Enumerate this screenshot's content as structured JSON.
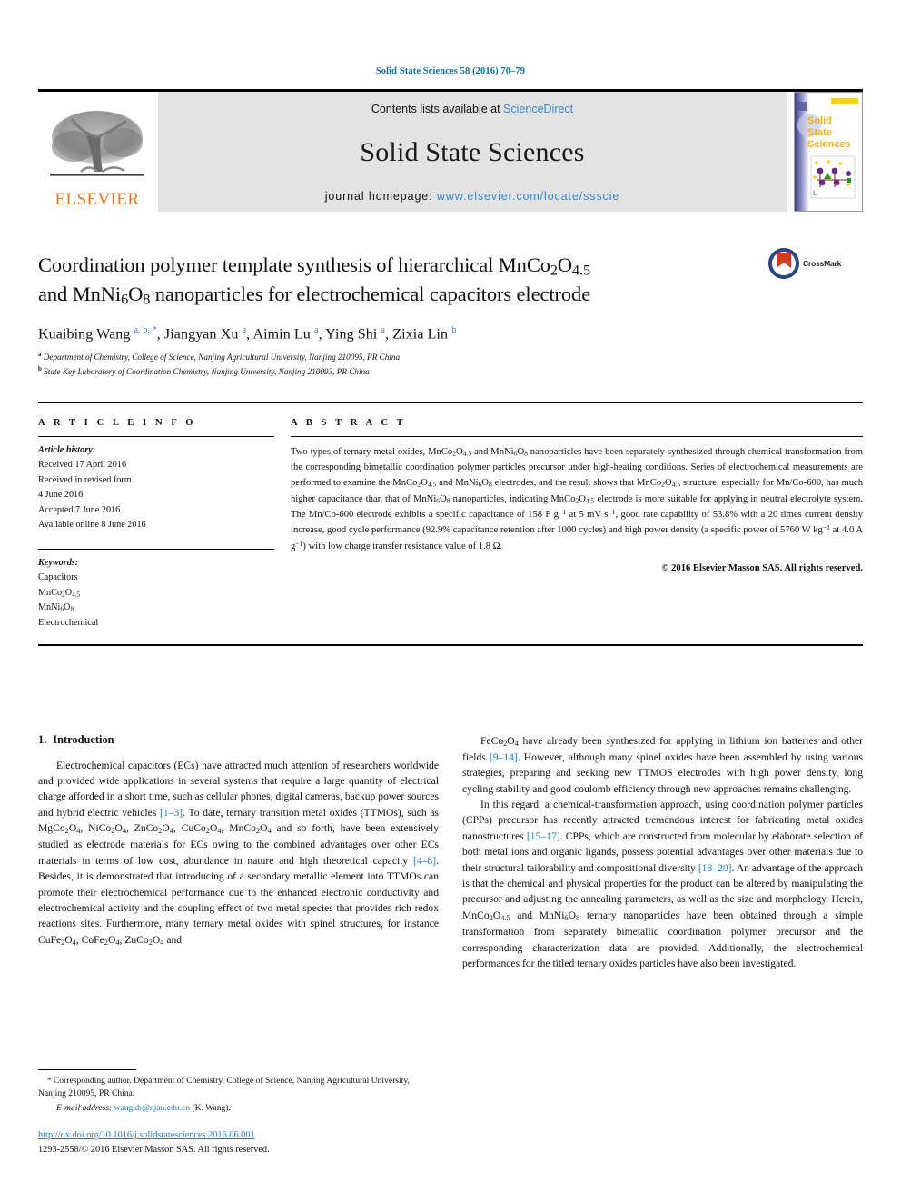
{
  "running_head": "Solid State Sciences 58 (2016) 70–79",
  "masthead": {
    "elsevier_wordmark": "ELSEVIER",
    "contents_prefix": "Contents lists available at ",
    "contents_link": "ScienceDirect",
    "journal_name": "Solid State Sciences",
    "homepage_prefix": "journal homepage: ",
    "homepage_url": "www.elsevier.com/locate/ssscie",
    "cover_title_lines": [
      "Solid",
      "State",
      "Sciences"
    ],
    "colors": {
      "link_blue": "#3a87c8",
      "elsevier_orange": "#E87722",
      "box_gray": "#e3e3e3",
      "running_head_blue": "#0b6fa4"
    }
  },
  "article": {
    "title_line1": "Coordination polymer template synthesis of hierarchical MnCo<sub>2</sub>O<sub>4.5</sub>",
    "title_line2": "and MnNi<sub>6</sub>O<sub>8</sub> nanoparticles for electrochemical capacitors electrode",
    "crossmark_label": "CrossMark",
    "authors_html": "Kuaibing Wang <span class=\"aff-mark\">a, b, *</span>, Jiangyan Xu <span class=\"aff-mark\">a</span>, Aimin Lu <span class=\"aff-mark\">a</span>, Ying Shi <span class=\"aff-mark\">a</span>, Zixia Lin <span class=\"aff-mark\">b</span>",
    "affiliation_a": "Department of Chemistry, College of Science, Nanjing Agricultural University, Nanjing 210095, PR China",
    "affiliation_b": "State Key Laboratory of Coordination Chemistry, Nanjing University, Nanjing 210093, PR China"
  },
  "article_info": {
    "heading": "A R T I C L E   I N F O",
    "history_label": "Article history:",
    "history": [
      "Received 17 April 2016",
      "Received in revised form",
      "4 June 2016",
      "Accepted 7 June 2016",
      "Available online 8 June 2016"
    ],
    "keywords_label": "Keywords:",
    "keywords_html": [
      "Capacitors",
      "MnCo<sub>2</sub>O<sub>4.5</sub>",
      "MnNi<sub>6</sub>O<sub>8</sub>",
      "Electrochemical"
    ]
  },
  "abstract": {
    "heading": "A B S T R A C T",
    "text_html": "Two types of ternary metal oxides, MnCo<sub>2</sub>O<sub>4.5</sub> and MnNi<sub>6</sub>O<sub>8</sub> nanoparticles have been separately synthesized through chemical transformation from the corresponding bimetallic coordination polymer particles precursor under high-heating conditions. Series of electrochemical measurements are performed to examine the MnCo<sub>2</sub>O<sub>4.5</sub> and MnNi<sub>6</sub>O<sub>8</sub> electrodes, and the result shows that MnCo<sub>2</sub>O<sub>4.5</sub> structure, especially for Mn/Co-600, has much higher capacitance than that of MnNi<sub>6</sub>O<sub>8</sub> nanoparticles, indicating MnCo<sub>2</sub>O<sub>4.5</sub> electrode is more suitable for applying in neutral electrolyte system. The Mn/Co-600 electrode exhibits a specific capacitance of 158 F g<sup>−1</sup> at 5 mV s<sup>−1</sup>, good rate capability of 53.8% with a 20 times current density increase, good cycle performance (92.9% capacitance retention after 1000 cycles) and high power density (a specific power of 5760 W kg<sup>−1</sup> at 4.0 A g<sup>−1</sup>) with low charge transfer resistance value of 1.8 Ω.",
    "copyright": "© 2016 Elsevier Masson SAS. All rights reserved."
  },
  "introduction": {
    "number": "1.",
    "title": "Introduction",
    "left_paragraphs_html": [
      "Electrochemical capacitors (ECs) have attracted much attention of researchers worldwide and provided wide applications in several systems that require a large quantity of electrical charge afforded in a short time, such as cellular phones, digital cameras, backup power sources and hybrid electric vehicles <span class=\"ref\">[1–3]</span>. To date, ternary transition metal oxides (TTMOs), such as MgCo<sub>2</sub>O<sub>4</sub>, NiCo<sub>2</sub>O<sub>4</sub>, ZnCo<sub>2</sub>O<sub>4</sub>, CuCo<sub>2</sub>O<sub>4</sub>, MnCo<sub>2</sub>O<sub>4</sub> and so forth, have been extensively studied as electrode materials for ECs owing to the combined advantages over other ECs materials in terms of low cost, abundance in nature and high theoretical capacity <span class=\"ref\">[4–8]</span>. Besides, it is demonstrated that introducing of a secondary metallic element into TTMOs can promote their electrochemical performance due to the enhanced electronic conductivity and electrochemical activity and the coupling effect of two metal species that provides rich redox reactions sites. Furthermore, many ternary metal oxides with spinel structures, for instance CuFe<sub>2</sub>O<sub>4</sub>, CoFe<sub>2</sub>O<sub>4</sub>, ZnCo<sub>2</sub>O<sub>4</sub> and"
    ],
    "right_paragraphs_html": [
      "FeCo<sub>2</sub>O<sub>4</sub> have already been synthesized for applying in lithium ion batteries and other fields <span class=\"ref\">[9–14]</span>. However, although many spinel oxides have been assembled by using various strategies, preparing and seeking new TTMOS electrodes with high power density, long cycling stability and good coulomb efficiency through new approaches remains challenging.",
      "In this regard, a chemical-transformation approach, using coordination polymer particles (CPPs) precursor has recently attracted tremendous interest for fabricating metal oxides nanostructures <span class=\"ref\">[15–17]</span>. CPPs, which are constructed from molecular by elaborate selection of both metal ions and organic ligands, possess potential advantages over other materials due to their structural tailorability and compositional diversity <span class=\"ref\">[18–20]</span>. An advantage of the approach is that the chemical and physical properties for the product can be altered by manipulating the precursor and adjusting the annealing parameters, as well as the size and morphology. Herein, MnCo<sub>2</sub>O<sub>4.5</sub> and MnNi<sub>6</sub>O<sub>8</sub> ternary nanoparticles have been obtained through a simple transformation from separately bimetallic coordination polymer precursor and the corresponding characterization data are provided. Additionally, the electrochemical performances for the titled ternary oxides particles have also been investigated."
    ]
  },
  "footnote": {
    "corresponding_html": "<span class=\"star\">*</span> Corresponding author. Department of Chemistry, College of Science, Nanjing Agricultural University, Nanjing 210095, PR China.",
    "email_label": "E-mail address:",
    "email_address": "wangkb@njau.edu.cn",
    "email_suffix": "(K. Wang).",
    "doi": "http://dx.doi.org/10.1016/j.solidstatesciences.2016.06.001",
    "issn_line": "1293-2558/© 2016 Elsevier Masson SAS. All rights reserved."
  }
}
